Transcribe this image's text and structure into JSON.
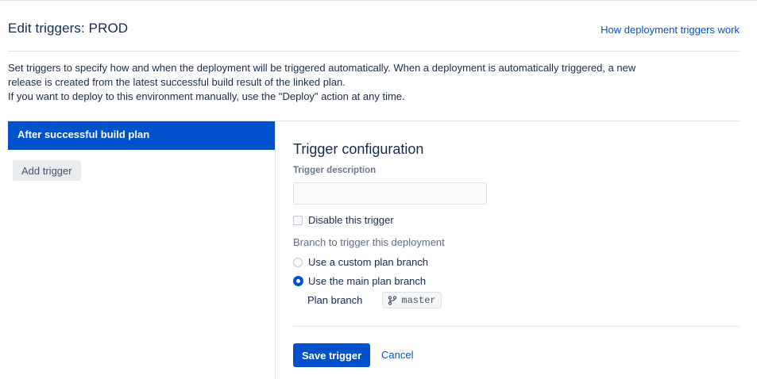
{
  "header": {
    "title": "Edit triggers: PROD",
    "help_link": "How deployment triggers work"
  },
  "intro": {
    "line1": "Set triggers to specify how and when the deployment will be triggered automatically. When a deployment is automatically triggered, a new",
    "line2": "release is created from the latest successful build result of the linked plan.",
    "line3": "If you want to deploy to this environment manually, use the \"Deploy\" action at any time."
  },
  "sidebar": {
    "items": [
      {
        "label": "After successful build plan",
        "selected": true
      }
    ],
    "add_trigger_label": "Add trigger"
  },
  "config": {
    "heading": "Trigger configuration",
    "description_label": "Trigger description",
    "description_value": "",
    "disable_label": "Disable this trigger",
    "disable_checked": false,
    "branch_section_label": "Branch to trigger this deployment",
    "branch_options": [
      {
        "label": "Use a custom plan branch",
        "selected": false
      },
      {
        "label": "Use the main plan branch",
        "selected": true
      }
    ],
    "plan_branch_label": "Plan branch",
    "plan_branch_value": "master",
    "plan_branch_icon": "branch-icon"
  },
  "actions": {
    "save_label": "Save trigger",
    "cancel_label": "Cancel"
  },
  "colors": {
    "accent": "#0052cc",
    "border": "#dfe1e6",
    "text": "#172b4d"
  }
}
